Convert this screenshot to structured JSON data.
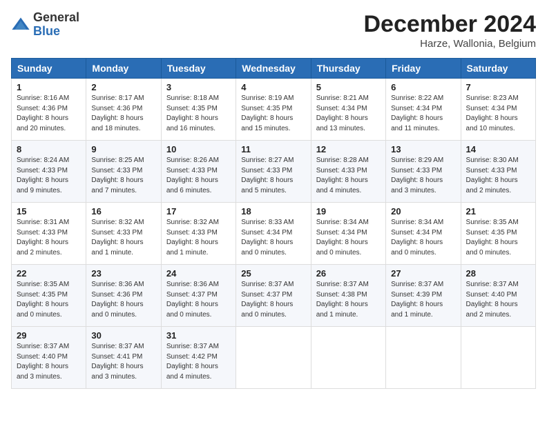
{
  "logo": {
    "general": "General",
    "blue": "Blue"
  },
  "header": {
    "month": "December 2024",
    "location": "Harze, Wallonia, Belgium"
  },
  "weekdays": [
    "Sunday",
    "Monday",
    "Tuesday",
    "Wednesday",
    "Thursday",
    "Friday",
    "Saturday"
  ],
  "weeks": [
    [
      {
        "day": "1",
        "sunrise": "8:16 AM",
        "sunset": "4:36 PM",
        "daylight": "8 hours and 20 minutes."
      },
      {
        "day": "2",
        "sunrise": "8:17 AM",
        "sunset": "4:36 PM",
        "daylight": "8 hours and 18 minutes."
      },
      {
        "day": "3",
        "sunrise": "8:18 AM",
        "sunset": "4:35 PM",
        "daylight": "8 hours and 16 minutes."
      },
      {
        "day": "4",
        "sunrise": "8:19 AM",
        "sunset": "4:35 PM",
        "daylight": "8 hours and 15 minutes."
      },
      {
        "day": "5",
        "sunrise": "8:21 AM",
        "sunset": "4:34 PM",
        "daylight": "8 hours and 13 minutes."
      },
      {
        "day": "6",
        "sunrise": "8:22 AM",
        "sunset": "4:34 PM",
        "daylight": "8 hours and 11 minutes."
      },
      {
        "day": "7",
        "sunrise": "8:23 AM",
        "sunset": "4:34 PM",
        "daylight": "8 hours and 10 minutes."
      }
    ],
    [
      {
        "day": "8",
        "sunrise": "8:24 AM",
        "sunset": "4:33 PM",
        "daylight": "8 hours and 9 minutes."
      },
      {
        "day": "9",
        "sunrise": "8:25 AM",
        "sunset": "4:33 PM",
        "daylight": "8 hours and 7 minutes."
      },
      {
        "day": "10",
        "sunrise": "8:26 AM",
        "sunset": "4:33 PM",
        "daylight": "8 hours and 6 minutes."
      },
      {
        "day": "11",
        "sunrise": "8:27 AM",
        "sunset": "4:33 PM",
        "daylight": "8 hours and 5 minutes."
      },
      {
        "day": "12",
        "sunrise": "8:28 AM",
        "sunset": "4:33 PM",
        "daylight": "8 hours and 4 minutes."
      },
      {
        "day": "13",
        "sunrise": "8:29 AM",
        "sunset": "4:33 PM",
        "daylight": "8 hours and 3 minutes."
      },
      {
        "day": "14",
        "sunrise": "8:30 AM",
        "sunset": "4:33 PM",
        "daylight": "8 hours and 2 minutes."
      }
    ],
    [
      {
        "day": "15",
        "sunrise": "8:31 AM",
        "sunset": "4:33 PM",
        "daylight": "8 hours and 2 minutes."
      },
      {
        "day": "16",
        "sunrise": "8:32 AM",
        "sunset": "4:33 PM",
        "daylight": "8 hours and 1 minute."
      },
      {
        "day": "17",
        "sunrise": "8:32 AM",
        "sunset": "4:33 PM",
        "daylight": "8 hours and 1 minute."
      },
      {
        "day": "18",
        "sunrise": "8:33 AM",
        "sunset": "4:34 PM",
        "daylight": "8 hours and 0 minutes."
      },
      {
        "day": "19",
        "sunrise": "8:34 AM",
        "sunset": "4:34 PM",
        "daylight": "8 hours and 0 minutes."
      },
      {
        "day": "20",
        "sunrise": "8:34 AM",
        "sunset": "4:34 PM",
        "daylight": "8 hours and 0 minutes."
      },
      {
        "day": "21",
        "sunrise": "8:35 AM",
        "sunset": "4:35 PM",
        "daylight": "8 hours and 0 minutes."
      }
    ],
    [
      {
        "day": "22",
        "sunrise": "8:35 AM",
        "sunset": "4:35 PM",
        "daylight": "8 hours and 0 minutes."
      },
      {
        "day": "23",
        "sunrise": "8:36 AM",
        "sunset": "4:36 PM",
        "daylight": "8 hours and 0 minutes."
      },
      {
        "day": "24",
        "sunrise": "8:36 AM",
        "sunset": "4:37 PM",
        "daylight": "8 hours and 0 minutes."
      },
      {
        "day": "25",
        "sunrise": "8:37 AM",
        "sunset": "4:37 PM",
        "daylight": "8 hours and 0 minutes."
      },
      {
        "day": "26",
        "sunrise": "8:37 AM",
        "sunset": "4:38 PM",
        "daylight": "8 hours and 1 minute."
      },
      {
        "day": "27",
        "sunrise": "8:37 AM",
        "sunset": "4:39 PM",
        "daylight": "8 hours and 1 minute."
      },
      {
        "day": "28",
        "sunrise": "8:37 AM",
        "sunset": "4:40 PM",
        "daylight": "8 hours and 2 minutes."
      }
    ],
    [
      {
        "day": "29",
        "sunrise": "8:37 AM",
        "sunset": "4:40 PM",
        "daylight": "8 hours and 3 minutes."
      },
      {
        "day": "30",
        "sunrise": "8:37 AM",
        "sunset": "4:41 PM",
        "daylight": "8 hours and 3 minutes."
      },
      {
        "day": "31",
        "sunrise": "8:37 AM",
        "sunset": "4:42 PM",
        "daylight": "8 hours and 4 minutes."
      },
      null,
      null,
      null,
      null
    ]
  ]
}
